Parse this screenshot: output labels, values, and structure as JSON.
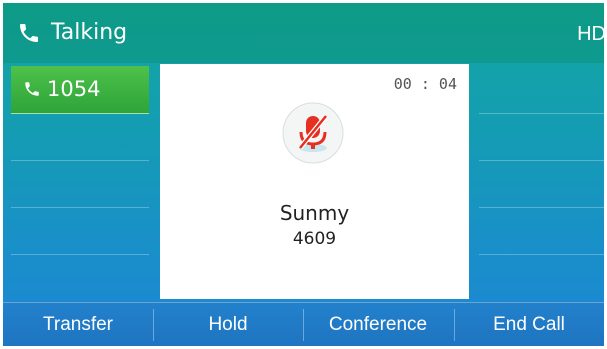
{
  "status_bar": {
    "title": "Talking",
    "hd_label": "HD",
    "icon": "phone-handset-icon"
  },
  "line_keys": [
    {
      "label": "1054",
      "active": true,
      "icon": "phone-handset-icon"
    },
    {
      "label": "",
      "active": false
    },
    {
      "label": "",
      "active": false
    },
    {
      "label": "",
      "active": false
    },
    {
      "label": "",
      "active": false
    }
  ],
  "call": {
    "duration": "00 : 04",
    "contact_name": "Sunmy",
    "contact_number": "4609",
    "status_icon": "muted-microphone-icon"
  },
  "soft_keys": [
    "Transfer",
    "Hold",
    "Conference",
    "End Call"
  ],
  "colors": {
    "accent_green": "#2ea43a",
    "mute_red": "#e63022",
    "background_teal": "#13a8a0",
    "background_blue": "#1d86d6"
  }
}
